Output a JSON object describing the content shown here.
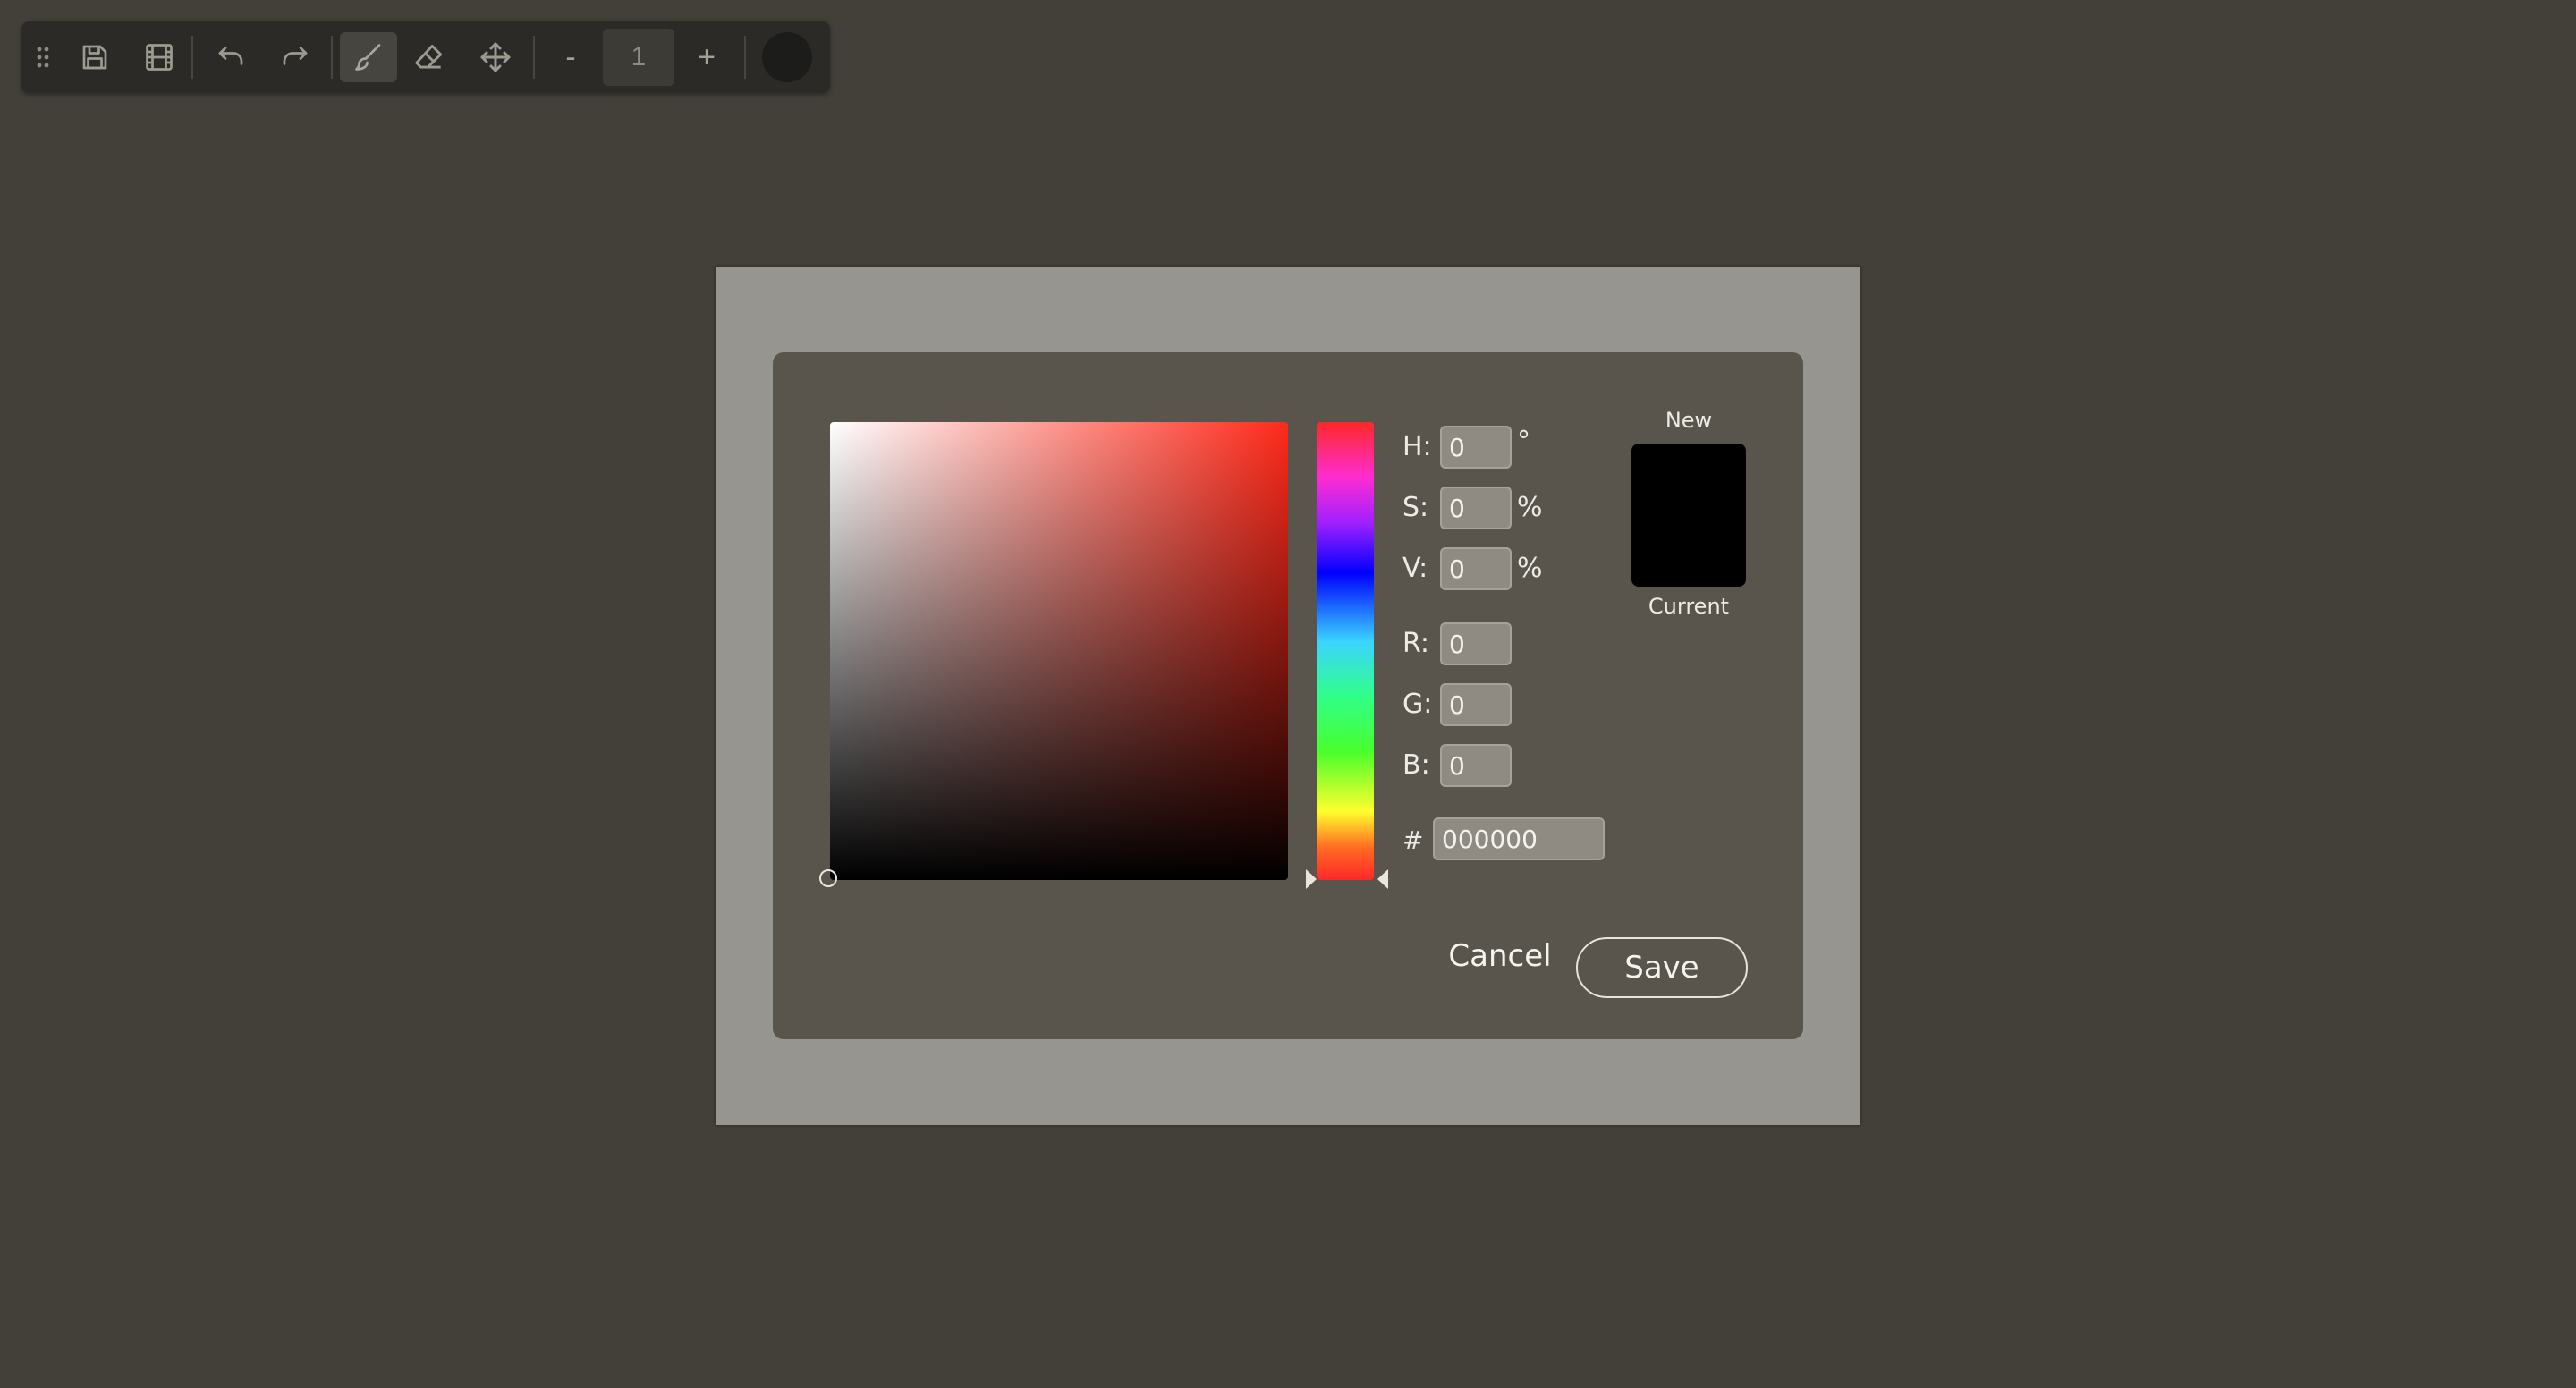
{
  "toolbar": {
    "icons": [
      "drag-handle-icon",
      "save-icon",
      "film-icon",
      "undo-icon",
      "redo-icon",
      "brush-icon",
      "eraser-icon",
      "move-icon"
    ],
    "zoom_out_label": "-",
    "brush_size": "1",
    "zoom_in_label": "+",
    "current_color": "#1c1c1a",
    "active_tool": "brush"
  },
  "picker": {
    "hue_value": "0",
    "hue_unit": "°",
    "sat_value": "0",
    "sat_unit": "%",
    "val_value": "0",
    "val_unit": "%",
    "r_value": "0",
    "g_value": "0",
    "b_value": "0",
    "hex_value": "000000",
    "labels": {
      "h": "H:",
      "s": "S:",
      "v": "V:",
      "r": "R:",
      "g": "G:",
      "b": "B:",
      "hash": "#"
    },
    "new_label": "New",
    "current_label": "Current",
    "new_color": "#000000",
    "current_color": "#000000",
    "cancel_label": "Cancel",
    "save_label": "Save"
  }
}
